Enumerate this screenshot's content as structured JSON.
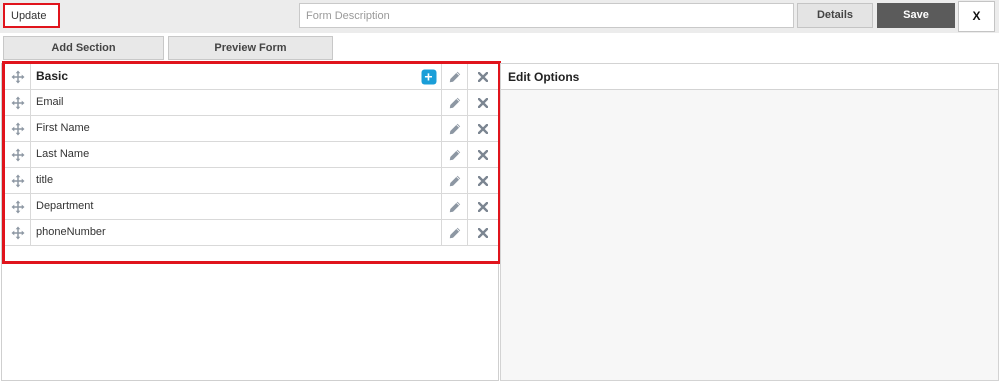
{
  "header": {
    "form_name_value": "Update",
    "description_placeholder": "Form Description",
    "details_label": "Details",
    "save_label": "Save",
    "close_label": "X"
  },
  "toolbar": {
    "add_section_label": "Add Section",
    "preview_form_label": "Preview Form"
  },
  "section": {
    "title": "Basic",
    "add_icon": "+",
    "fields": [
      {
        "label": "Email"
      },
      {
        "label": "First Name"
      },
      {
        "label": "Last Name"
      },
      {
        "label": "title"
      },
      {
        "label": "Department"
      },
      {
        "label": "phoneNumber"
      }
    ]
  },
  "edit_options": {
    "title": "Edit Options"
  },
  "colors": {
    "highlight": "#e0141c",
    "save_bg": "#5b5b5b",
    "add_icon_bg": "#1a9ed8"
  }
}
